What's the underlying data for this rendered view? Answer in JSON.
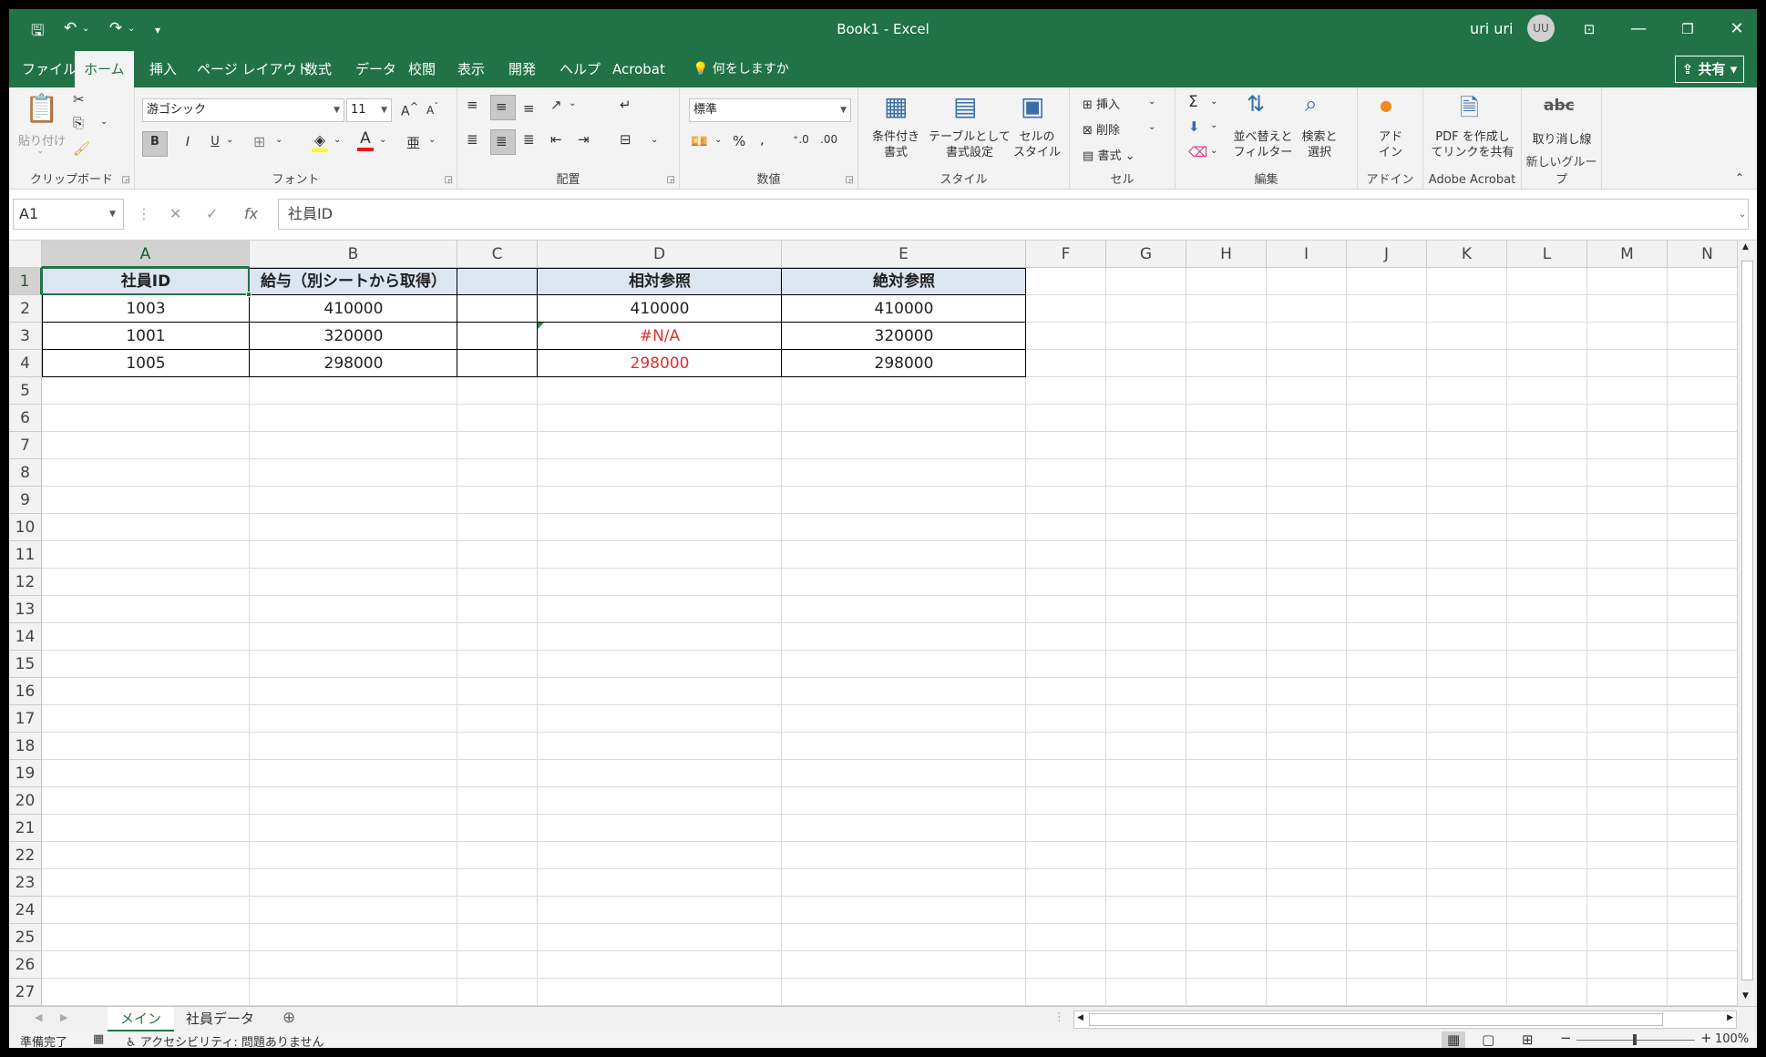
{
  "window": {
    "title": "Book1  -  Excel",
    "user": "uri uri",
    "avatar_initials": "UU"
  },
  "ribbon_tabs": [
    "ファイル",
    "ホーム",
    "挿入",
    "ページ レイアウト",
    "数式",
    "データ",
    "校閲",
    "表示",
    "開発",
    "ヘルプ",
    "Acrobat",
    "何をしますか"
  ],
  "active_tab": "ホーム",
  "share_label": "共有",
  "ribbon": {
    "clipboard": {
      "paste": "貼り付け",
      "label": "クリップボード"
    },
    "font": {
      "name": "游ゴシック",
      "size": "11",
      "bold": "B",
      "italic": "I",
      "underline": "U",
      "label": "フォント"
    },
    "alignment": {
      "label": "配置"
    },
    "number": {
      "format": "標準",
      "label": "数値"
    },
    "styles": {
      "conditional": "条件付き\n書式",
      "table": "テーブルとして\n書式設定",
      "cell": "セルの\nスタイル",
      "label": "スタイル"
    },
    "cells": {
      "insert": "挿入",
      "delete": "削除",
      "format": "書式",
      "label": "セル"
    },
    "editing": {
      "sort": "並べ替えと\nフィルター",
      "find": "検索と\n選択",
      "label": "編集"
    },
    "addins": {
      "addin": "アド\nイン",
      "label": "アドイン"
    },
    "acrobat": {
      "pdf": "PDF を作成し\nてリンクを共有",
      "label": "Adobe Acrobat"
    },
    "newgroup": {
      "strike": "取り消し線",
      "label": "新しいグループ"
    }
  },
  "formula_bar": {
    "name_box": "A1",
    "value": "社員ID"
  },
  "columns": [
    "A",
    "B",
    "C",
    "D",
    "E",
    "F",
    "G",
    "H",
    "I",
    "J",
    "K",
    "L",
    "M",
    "N"
  ],
  "row_count": 27,
  "selected_column": "A",
  "selected_row": 1,
  "cells": {
    "A1": "社員ID",
    "B1": "給与（別シートから取得）",
    "C1": "",
    "D1": "相対参照",
    "E1": "絶対参照",
    "A2": "1003",
    "B2": "410000",
    "D2": "410000",
    "E2": "410000",
    "A3": "1001",
    "B3": "320000",
    "D3": "#N/A",
    "E3": "320000",
    "A4": "1005",
    "B4": "298000",
    "D4": "298000",
    "E4": "298000"
  },
  "red_cells": [
    "D3",
    "D4"
  ],
  "sheets": [
    "メイン",
    "社員データ"
  ],
  "active_sheet": "メイン",
  "status": {
    "ready": "準備完了",
    "accessibility": "アクセシビリティ: 問題ありません",
    "zoom": "100%"
  }
}
